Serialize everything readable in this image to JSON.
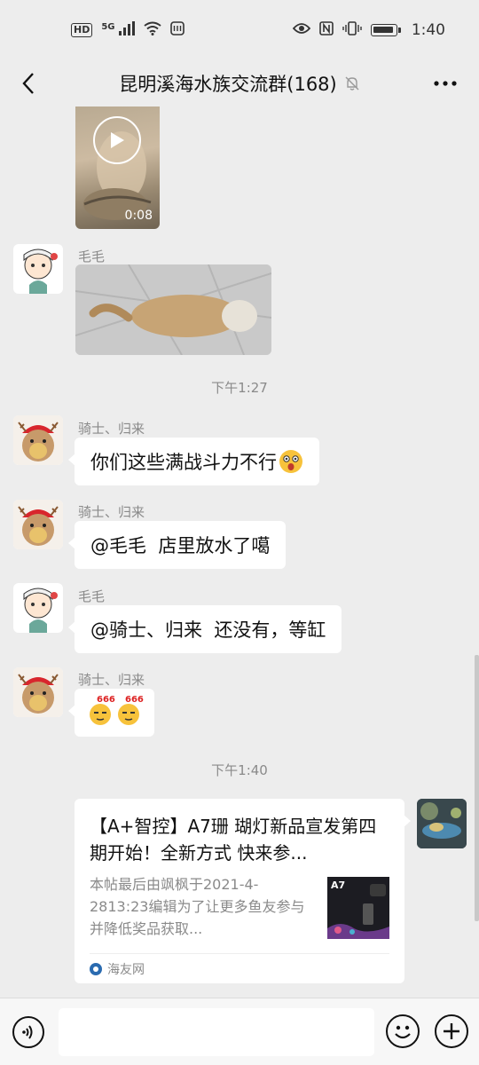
{
  "status_bar": {
    "network_hd": "HD",
    "network_gen": "5G",
    "time": "1:40",
    "icons": [
      "signal-icon",
      "wifi-icon",
      "app-notification-icon",
      "eye-icon",
      "nfc-icon",
      "vibrate-icon",
      "battery-icon"
    ]
  },
  "header": {
    "title": "昆明溪海水族交流群(168)",
    "back_icon": "chevron-left-icon",
    "mute_icon": "bell-off-icon",
    "more_icon": "more-dots-icon"
  },
  "messages": {
    "video": {
      "duration": "0:08"
    },
    "m1": {
      "sender": "毛毛"
    },
    "ts1": "下午1:27",
    "m2": {
      "sender": "骑士、归来",
      "text": "你们这些满战斗力不行"
    },
    "m3": {
      "sender": "骑士、归来",
      "text": "@毛毛  店里放水了噶"
    },
    "m4": {
      "sender": "毛毛",
      "text": "@骑士、归来  还没有，等缸"
    },
    "m5": {
      "sender": "骑士、归来",
      "emoji_label": "666"
    },
    "ts2": "下午1:40",
    "link": {
      "title": "【A+智控】A7珊 瑚灯新品宣发第四期开始！全新方式  快来参...",
      "description": "本帖最后由飒枫于2021-4-2813:23编辑为了让更多鱼友参与并降低奖品获取...",
      "thumb_label": "A7",
      "source": "海友网"
    }
  },
  "input_bar": {
    "placeholder": "",
    "voice_icon": "voice-icon",
    "emoji_icon": "smiley-icon",
    "plus_icon": "plus-icon"
  }
}
